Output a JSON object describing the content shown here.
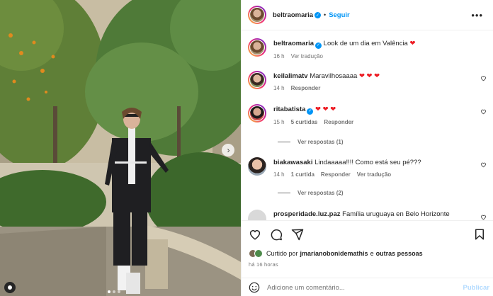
{
  "post": {
    "author": "beltraomaria",
    "follow_label": "Seguir",
    "separator": "•",
    "more": "•••"
  },
  "caption": {
    "username": "beltraomaria",
    "text": "Look de um dia em Valência",
    "emoji": "❤",
    "age": "16 h",
    "translate": "Ver tradução"
  },
  "comments": [
    {
      "username": "keilalimatv",
      "text": "Maravilhosaaaa",
      "emoji": "❤ ❤ ❤",
      "age": "14 h",
      "likes": "",
      "reply": "Responder",
      "translate": ""
    },
    {
      "username": "ritabatista",
      "text": "",
      "emoji": "❤ ❤ ❤",
      "age": "15 h",
      "likes": "5 curtidas",
      "reply": "Responder",
      "translate": "",
      "view_replies": "Ver respostas (1)"
    },
    {
      "username": "biakawasaki",
      "text": "Lindaaaaa!!!! Como está seu pé???",
      "emoji": "",
      "age": "14 h",
      "likes": "1 curtida",
      "reply": "Responder",
      "translate": "Ver tradução",
      "view_replies": "Ver respostas (2)"
    },
    {
      "username": "prosperidade.luz.paz",
      "text": "Família uruguaya en Belo Horizonte"
    }
  ],
  "liked_by": {
    "prefix": "Curtido por",
    "user": "jmarianobonidemathis",
    "conj": "e",
    "others": "outras pessoas"
  },
  "timestamp": "há 16 horas",
  "comment_box": {
    "placeholder": "Adicione um comentário...",
    "publish": "Publicar"
  },
  "colors": {
    "accent": "#0095f6",
    "heart": "#ed1c24",
    "muted": "#737373"
  },
  "icons": [
    "heart-icon",
    "comment-icon",
    "share-icon",
    "bookmark-icon",
    "emoji-icon",
    "verified-icon",
    "chevron-right-icon"
  ],
  "carousel": {
    "current": 1,
    "total": 3
  }
}
